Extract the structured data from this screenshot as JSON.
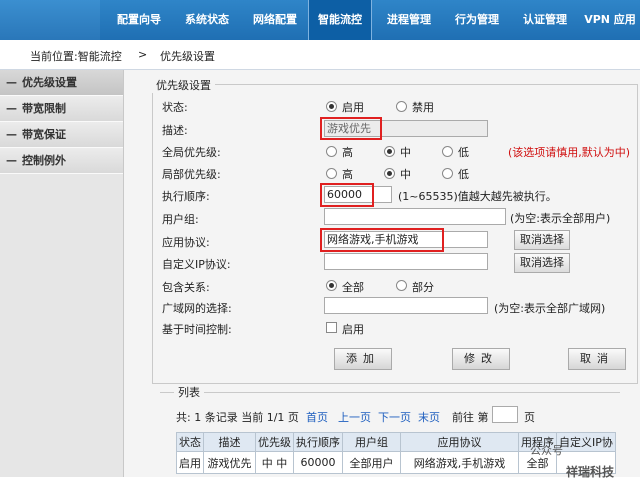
{
  "nav": {
    "items": [
      "配置向导",
      "系统状态",
      "网络配置",
      "智能流控",
      "进程管理",
      "行为管理",
      "认证管理",
      "VPN 应用"
    ],
    "active_index": 3
  },
  "breadcrumb": {
    "prefix": "当前位置:智能流控",
    "separator": ">",
    "current": "优先级设置"
  },
  "sidebar": {
    "items": [
      "优先级设置",
      "带宽限制",
      "带宽保证",
      "控制例外"
    ]
  },
  "form": {
    "legend": "优先级设置",
    "status_label": "状态:",
    "status_options": [
      "启用",
      "禁用"
    ],
    "desc_label": "描述:",
    "desc_value": "游戏优先",
    "global_label": "全局优先级:",
    "local_label": "局部优先级:",
    "priority_options": [
      "高",
      "中",
      "低"
    ],
    "global_warning": "(该选项请慎用,默认为中)",
    "order_label": "执行顺序:",
    "order_value": "60000",
    "order_hint": "(1~65535)值越大越先被执行。",
    "usergroup_label": "用户组:",
    "usergroup_hint": "(为空:表示全部用户)",
    "app_label": "应用协议:",
    "app_value": "网络游戏,手机游戏",
    "cancel_select": "取消选择",
    "custom_ip_label": "自定义IP协议:",
    "contain_label": "包含关系:",
    "contain_options": [
      "全部",
      "部分"
    ],
    "wan_label": "广域网的选择:",
    "wan_hint": "(为空:表示全部广域网)",
    "time_label": "基于时间控制:",
    "time_option": "启用",
    "add": "添加",
    "modify": "修改",
    "cancel": "取消"
  },
  "list": {
    "title": "列表",
    "summary": "共: 1 条记录 当前 1/1 页",
    "first": "首页",
    "prev": "上一页",
    "next": "下一页",
    "last": "末页",
    "goto": "前往 第",
    "page_suffix": "页",
    "columns": [
      "状态",
      "描述",
      "优先级",
      "执行顺序",
      "用户组",
      "应用协议",
      "用程序",
      "自定义IP协"
    ],
    "rows": [
      [
        "启用",
        "游戏优先",
        "中 中",
        "60000",
        "全部用户",
        "网络游戏,手机游戏",
        "全部",
        ""
      ]
    ]
  },
  "watermark": {
    "line1": "公众号",
    "line2": "祥瑞科技"
  },
  "colors": {
    "nav_bg": "#1f6fb3",
    "highlight_red": "#e02020",
    "warning_red": "#d01010",
    "link_blue": "#1f5fbf"
  }
}
